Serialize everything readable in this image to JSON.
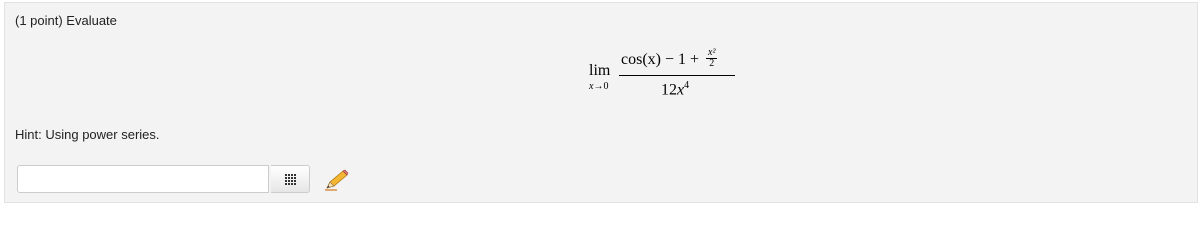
{
  "problem": {
    "intro": "(1 point) Evaluate",
    "hint": "Hint: Using power series."
  },
  "formula": {
    "lim_word": "lim",
    "lim_var": "x",
    "lim_arrow": "→",
    "lim_target": "0",
    "numerator_main": "cos(x) − 1 + ",
    "numerator_frac_num": "x²",
    "numerator_frac_den": "2",
    "denominator_coef": "12",
    "denominator_var": "x",
    "denominator_exp": "4"
  },
  "answer": {
    "value": "",
    "placeholder": ""
  },
  "icons": {
    "palette": "grid-icon",
    "edit": "pencil-icon"
  }
}
